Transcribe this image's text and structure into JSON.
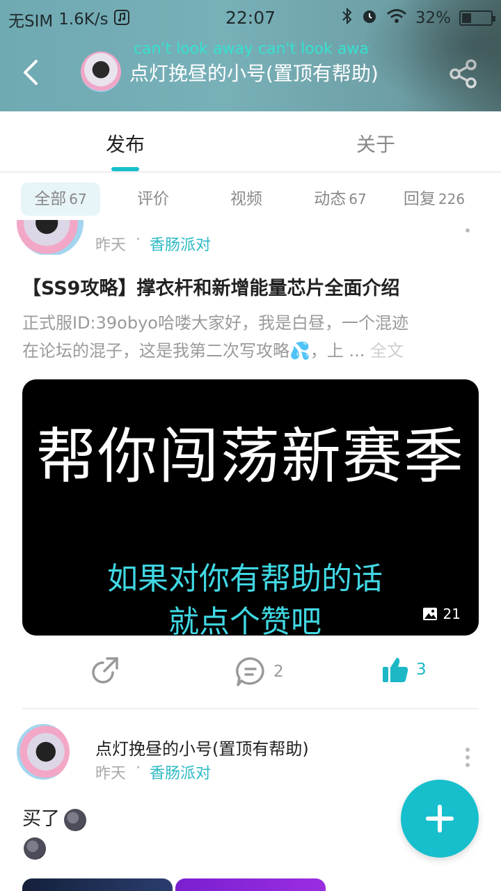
{
  "status_bar": {
    "carrier": "无SIM",
    "speed": "1.6K/s",
    "time": "22:07",
    "battery": "32%",
    "battery_level": 0.32,
    "icons": [
      "music-icon",
      "bluetooth-icon",
      "alarm-icon",
      "wifi-icon",
      "battery-icon"
    ]
  },
  "header": {
    "marquee": "can't look away can't look away",
    "title": "点灯挽昼的小号(置顶有帮助)",
    "back_icon": "back-arrow-icon",
    "share_icon": "share-icon"
  },
  "tabs": [
    {
      "label": "发布",
      "active": true
    },
    {
      "label": "关于",
      "active": false
    }
  ],
  "filters": [
    {
      "label": "全部",
      "count": "67",
      "active": true
    },
    {
      "label": "评价",
      "count": ""
    },
    {
      "label": "视频",
      "count": ""
    },
    {
      "label": "动态",
      "count": "67"
    },
    {
      "label": "回复",
      "count": "226"
    }
  ],
  "post1": {
    "time": "昨天",
    "dot": "·",
    "group": "香肠派对",
    "title": "【SS9攻略】撑衣杆和新增能量芯片全面介绍",
    "body_line1": "正式服ID:39obyo哈喽大家好，我是白昼，一个混迹",
    "body_line2": "在论坛的混子，这是我第二次写攻略💦，上 ...",
    "full_text": "全文",
    "cover": {
      "headline": "帮你闯荡新赛季",
      "subline1": "如果对你有帮助的话",
      "subline2": "就点个赞吧",
      "image_count": "21"
    },
    "comments": "2",
    "likes": "3"
  },
  "post2": {
    "author": "点灯挽昼的小号(置顶有帮助)",
    "time": "昨天",
    "dot": "·",
    "group": "香肠派对",
    "text": "买了"
  },
  "colors": {
    "accent": "#17bfcd",
    "group_link": "#2bb9c6",
    "header_bg": "#6fa9b2"
  }
}
